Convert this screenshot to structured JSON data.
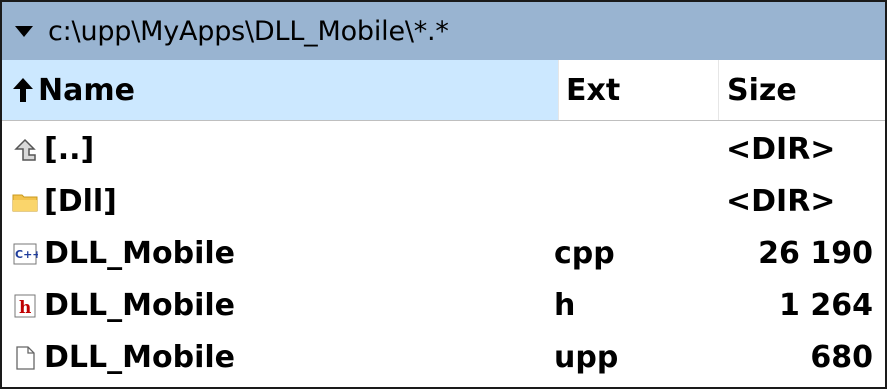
{
  "path_bar": {
    "path": "c:\\upp\\MyApps\\DLL_Mobile\\*.*",
    "icon": "triangle-down-icon"
  },
  "header": {
    "name_label": "Name",
    "ext_label": "Ext",
    "size_label": "Size",
    "sort_icon": "arrow-up-icon"
  },
  "files": [
    {
      "icon": "parent-dir-icon",
      "name": "[..]",
      "ext": "",
      "size": "<DIR>"
    },
    {
      "icon": "folder-icon",
      "name": "[Dll]",
      "ext": "",
      "size": "<DIR>"
    },
    {
      "icon": "cpp-file-icon",
      "name": "DLL_Mobile",
      "ext": "cpp",
      "size": "26 190"
    },
    {
      "icon": "h-file-icon",
      "name": "DLL_Mobile",
      "ext": "h",
      "size": "1 264"
    },
    {
      "icon": "file-icon",
      "name": "DLL_Mobile",
      "ext": "upp",
      "size": "680"
    }
  ],
  "colors": {
    "path_bar_bg": "#99b4d1",
    "sorted_header_bg": "#cce8ff"
  }
}
